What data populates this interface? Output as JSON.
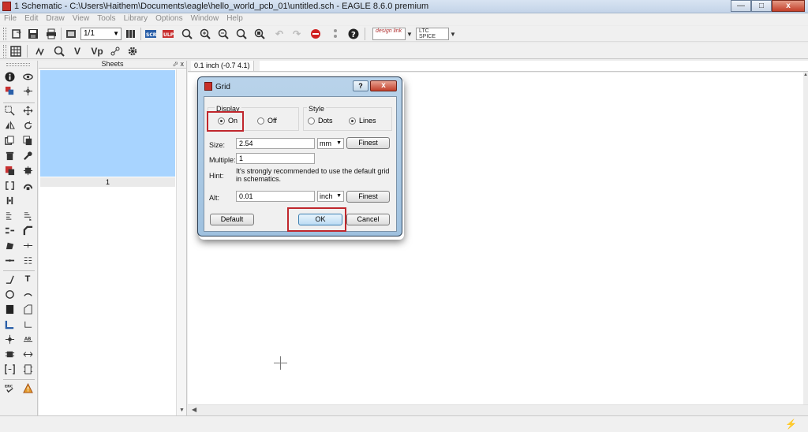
{
  "window": {
    "title": "1 Schematic - C:\\Users\\Haithem\\Documents\\eagle\\hello_world_pcb_01\\untitled.sch - EAGLE 8.6.0 premium",
    "minimize": "—",
    "maximize": "□",
    "close": "x"
  },
  "menu": [
    "File",
    "Edit",
    "Draw",
    "View",
    "Tools",
    "Library",
    "Options",
    "Window",
    "Help"
  ],
  "toolbar": {
    "sheet_combo": "1/1",
    "design_link": "design link",
    "ltc_spice": "LTC SPICE"
  },
  "toolbar2": {
    "v_label": "V",
    "vp_label": "Vp"
  },
  "left_tools": {
    "text_label": "T"
  },
  "sheets_panel": {
    "title": "Sheets",
    "header_buttons": "⬀ x",
    "sheet_number": "1"
  },
  "coordinate_readout": "0.1 inch (-0.7 4.1)",
  "grid_dialog": {
    "title": "Grid",
    "help_button": "?",
    "close_button": "x",
    "display": {
      "legend": "Display",
      "on": "On",
      "off": "Off",
      "selected": "On"
    },
    "style": {
      "legend": "Style",
      "dots": "Dots",
      "lines": "Lines",
      "selected": "Lines"
    },
    "size": {
      "label": "Size:",
      "value": "2.54",
      "unit": "mm",
      "finest": "Finest"
    },
    "multiple": {
      "label": "Multiple:",
      "value": "1"
    },
    "hint": {
      "label": "Hint:",
      "text": "It's strongly recommended to use the default grid in schematics."
    },
    "alt": {
      "label": "Alt:",
      "value": "0.01",
      "unit": "inch",
      "finest": "Finest"
    },
    "buttons": {
      "default": "Default",
      "ok": "OK",
      "cancel": "Cancel"
    }
  },
  "colors": {
    "sheet_thumbnail": "#a8d4ff",
    "highlight_box": "#c0272d"
  }
}
